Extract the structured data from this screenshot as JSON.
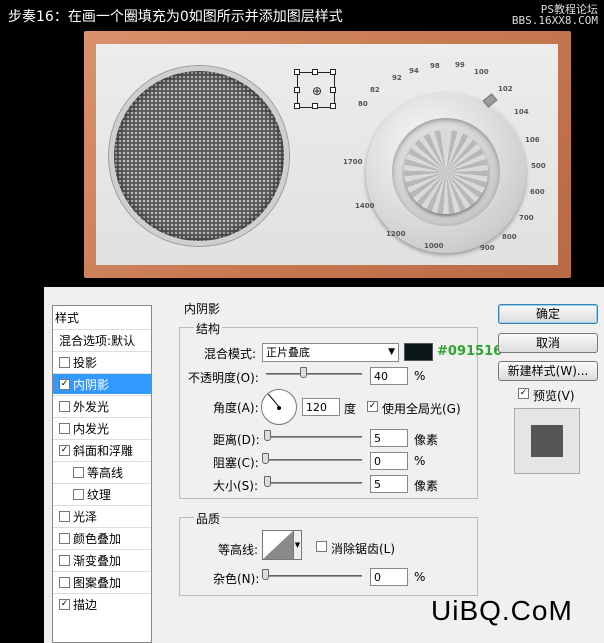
{
  "header": {
    "title": "步奏16：在画一个圈填充为0如图所示并添加图层样式",
    "watermark_line1": "PS教程论坛",
    "watermark_line2": "BBS.16XX8.COM"
  },
  "dial_numbers": [
    "98",
    "99",
    "100",
    "102",
    "104",
    "106",
    "500",
    "600",
    "700",
    "800",
    "900",
    "1000",
    "1200",
    "1400",
    "1700",
    "80",
    "82",
    "92",
    "94"
  ],
  "styles_panel": {
    "header": "样式",
    "items": [
      {
        "label": "混合选项:默认",
        "checkbox": false,
        "checked": false,
        "active": false,
        "sub": false
      },
      {
        "label": "投影",
        "checkbox": true,
        "checked": false,
        "active": false,
        "sub": false
      },
      {
        "label": "内阴影",
        "checkbox": true,
        "checked": true,
        "active": true,
        "sub": false
      },
      {
        "label": "外发光",
        "checkbox": true,
        "checked": false,
        "active": false,
        "sub": false
      },
      {
        "label": "内发光",
        "checkbox": true,
        "checked": false,
        "active": false,
        "sub": false
      },
      {
        "label": "斜面和浮雕",
        "checkbox": true,
        "checked": true,
        "active": false,
        "sub": false
      },
      {
        "label": "等高线",
        "checkbox": true,
        "checked": false,
        "active": false,
        "sub": true
      },
      {
        "label": "纹理",
        "checkbox": true,
        "checked": false,
        "active": false,
        "sub": true
      },
      {
        "label": "光泽",
        "checkbox": true,
        "checked": false,
        "active": false,
        "sub": false
      },
      {
        "label": "颜色叠加",
        "checkbox": true,
        "checked": false,
        "active": false,
        "sub": false
      },
      {
        "label": "渐变叠加",
        "checkbox": true,
        "checked": false,
        "active": false,
        "sub": false
      },
      {
        "label": "图案叠加",
        "checkbox": true,
        "checked": false,
        "active": false,
        "sub": false
      },
      {
        "label": "描边",
        "checkbox": true,
        "checked": true,
        "active": false,
        "sub": false
      }
    ]
  },
  "inner_shadow": {
    "section_title": "内阴影",
    "structure_title": "结构",
    "blend_mode_label": "混合模式:",
    "blend_mode_value": "正片叠底",
    "color_hex": "#091516",
    "opacity_label": "不透明度(O):",
    "opacity_value": "40",
    "opacity_pct": 0.4,
    "percent": "%",
    "angle_label": "角度(A):",
    "angle_value": "120",
    "degree": "度",
    "global_light_label": "使用全局光(G)",
    "global_light_checked": true,
    "distance_label": "距离(D):",
    "distance_value": "5",
    "pixels": "像素",
    "choke_label": "阻塞(C):",
    "choke_value": "0",
    "size_label": "大小(S):",
    "size_value": "5",
    "quality_title": "品质",
    "contour_label": "等高线:",
    "antialias_label": "消除锯齿(L)",
    "antialias_checked": false,
    "noise_label": "杂色(N):",
    "noise_value": "0"
  },
  "buttons": {
    "ok": "确定",
    "cancel": "取消",
    "new_style": "新建样式(W)...",
    "preview_label": "预览(V)",
    "preview_checked": true
  },
  "watermark_bottom": "UiBQ.CoM",
  "colors": {
    "swatch": "#091516",
    "accent_text": "#2ea32e",
    "selection": "#3399ff"
  }
}
